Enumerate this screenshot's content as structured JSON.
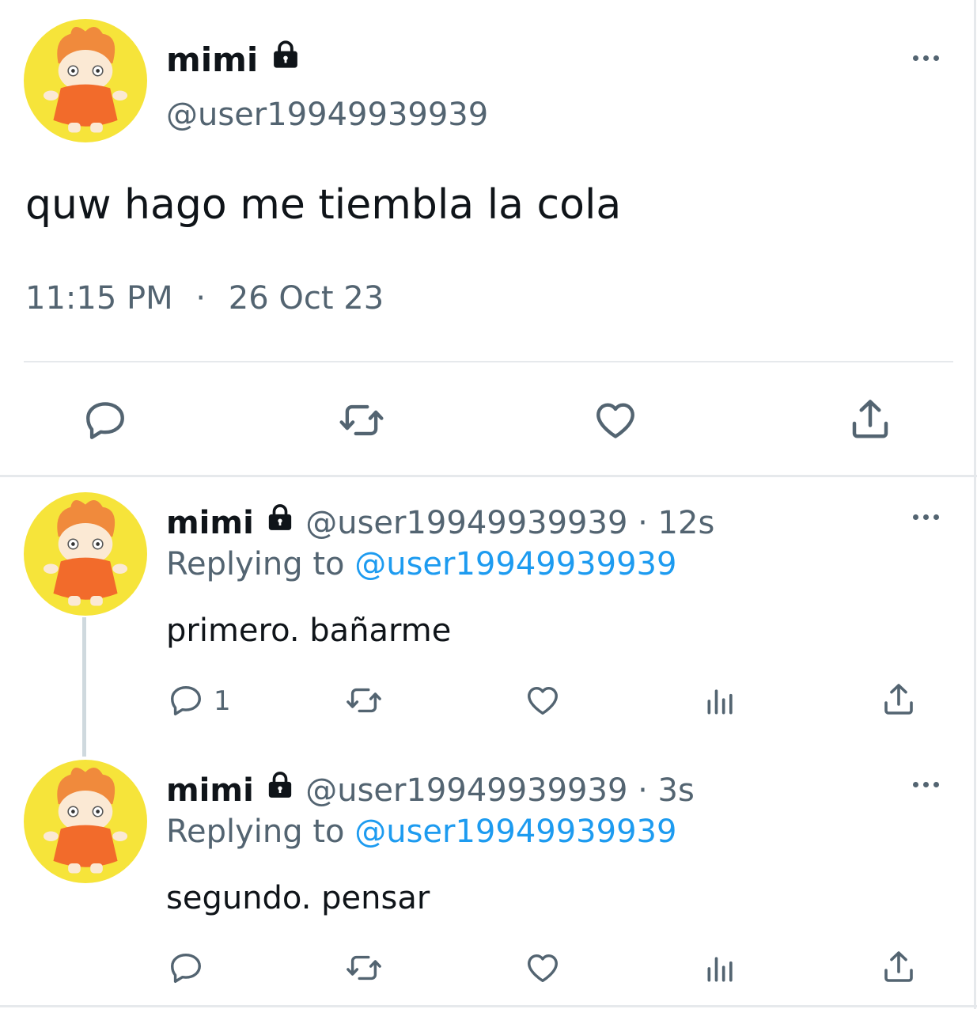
{
  "main_tweet": {
    "display_name": "mimi",
    "handle": "@user19949939939",
    "text": "quw hago me tiembla la cola",
    "time": "11:15 PM",
    "separator": "·",
    "date": "26 Oct 23"
  },
  "replies": [
    {
      "display_name": "mimi",
      "handle_time": "@user19949939939 · 12s",
      "replying_prefix": "Replying to",
      "replying_handle": "@user19949939939",
      "text": "primero. bañarme",
      "reply_count": "1"
    },
    {
      "display_name": "mimi",
      "handle_time": "@user19949939939 · 3s",
      "replying_prefix": "Replying to",
      "replying_handle": "@user19949939939",
      "text": "segundo. pensar",
      "reply_count": ""
    }
  ],
  "colors": {
    "text": "#0f1419",
    "muted": "#536471",
    "link": "#1d9bf0",
    "avatar_bg": "#f6e43a"
  },
  "icons": [
    "lock-icon",
    "more-icon",
    "reply-icon",
    "retweet-icon",
    "like-icon",
    "views-icon",
    "share-icon"
  ]
}
